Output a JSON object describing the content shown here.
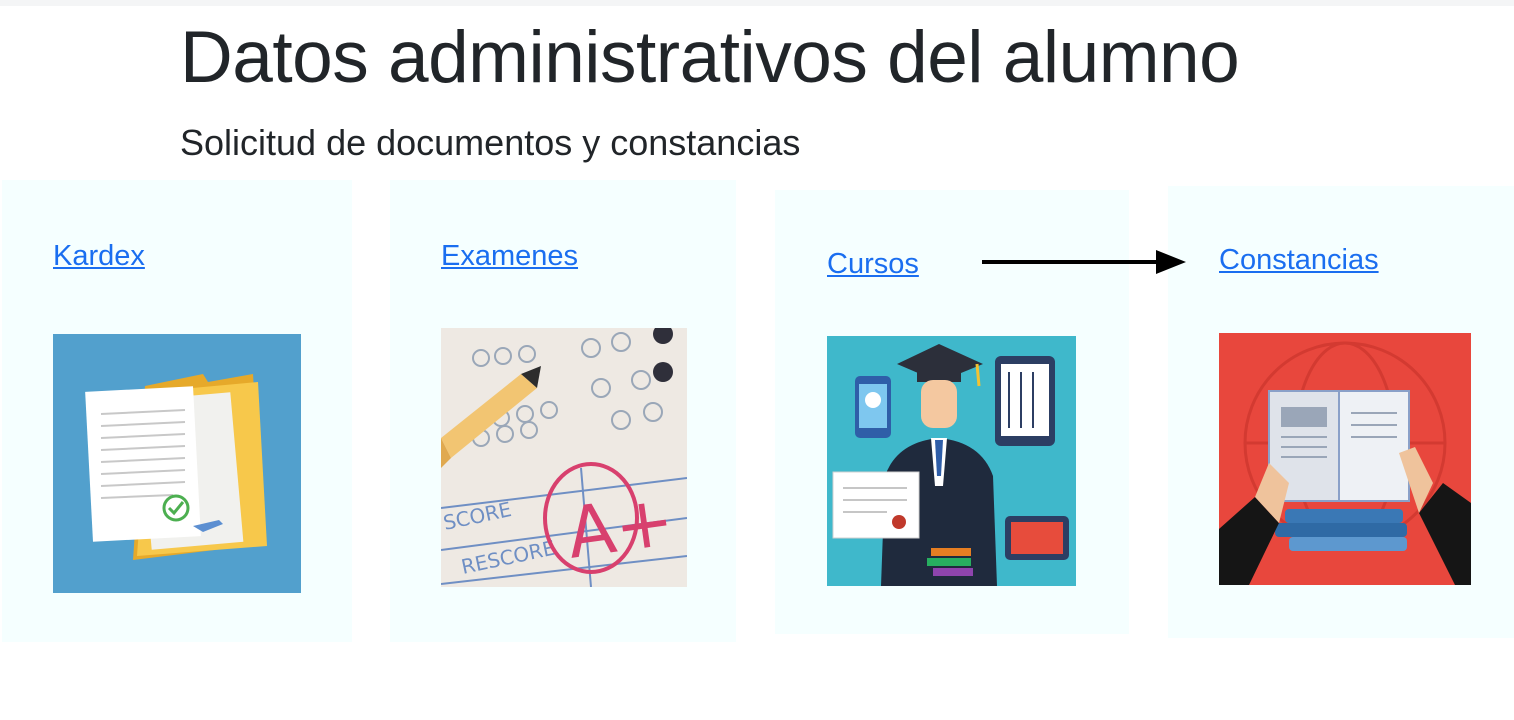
{
  "page": {
    "title": "Datos administrativos del alumno",
    "subtitle": "Solicitud de documentos y constancias"
  },
  "cards": [
    {
      "label": "Kardex",
      "icon": "kardex-document-icon",
      "image_bg": "#52a0cd"
    },
    {
      "label": "Examenes",
      "icon": "exam-answer-sheet-icon",
      "image_bg": "#eee9e3"
    },
    {
      "label": "Cursos",
      "icon": "graduate-courses-icon",
      "image_bg": "#3fb8cb"
    },
    {
      "label": "Constancias",
      "icon": "certificate-book-icon",
      "image_bg": "#e8473d"
    }
  ],
  "colors": {
    "link": "#1a6ef0",
    "card_background": "#f5ffff",
    "text": "#212529"
  }
}
